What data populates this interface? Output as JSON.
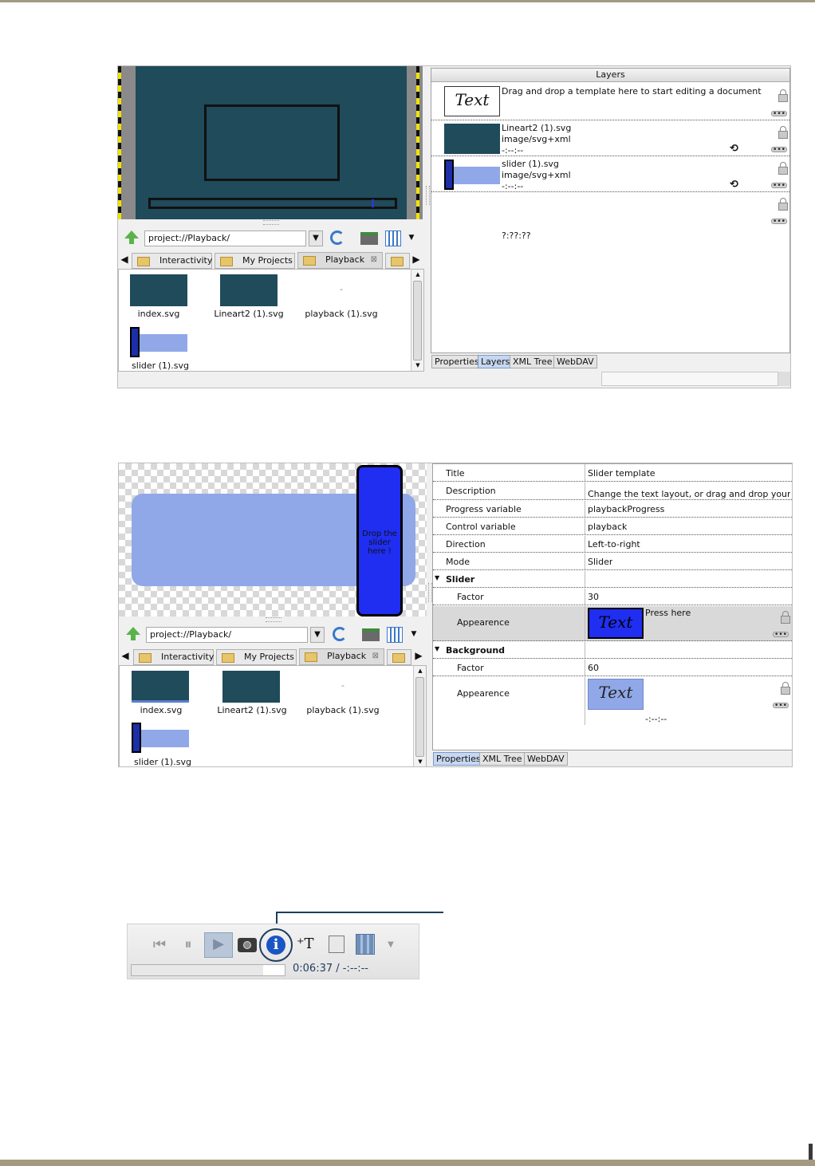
{
  "shot1": {
    "path": "project://Playback/",
    "tabs": [
      "Interactivity",
      "My Projects",
      "Playback"
    ],
    "files": [
      "index.svg",
      "Lineart2 (1).svg",
      "playback (1).svg",
      "slider (1).svg"
    ],
    "playback_thumb_text": "-",
    "layers": {
      "header": "Layers",
      "template_text": "Text",
      "template_hint": "Drag and drop a template here to start editing a document",
      "items": [
        {
          "name": "Lineart2 (1).svg",
          "mime": "image/svg+xml",
          "time": "-:--:--"
        },
        {
          "name": "slider (1).svg",
          "mime": "image/svg+xml",
          "time": "-:--:--"
        }
      ],
      "empty_time": "?:??:??"
    },
    "bottom_tabs": [
      "Properties",
      "Layers",
      "XML Tree",
      "WebDAV"
    ]
  },
  "shot2": {
    "drop_hint": "Drop the slider here !",
    "path": "project://Playback/",
    "tabs": [
      "Interactivity",
      "My Projects",
      "Playback"
    ],
    "files": [
      "index.svg",
      "Lineart2 (1).svg",
      "playback (1).svg",
      "slider (1).svg"
    ],
    "playback_thumb_text": "-",
    "properties": [
      {
        "key": "Title",
        "value": "Slider template"
      },
      {
        "key": "Description",
        "value": "Change the text layout, or drag and drop your ..."
      },
      {
        "key": "Progress variable",
        "value": "playbackProgress"
      },
      {
        "key": "Control variable",
        "value": "playback"
      },
      {
        "key": "Direction",
        "value": "Left-to-right"
      },
      {
        "key": "Mode",
        "value": "Slider"
      }
    ],
    "slider_group": {
      "label": "Slider",
      "factor_label": "Factor",
      "factor_value": "30",
      "appearance_label": "Appearence",
      "appearance_text": "Text",
      "appearance_hint": "Press here"
    },
    "background_group": {
      "label": "Background",
      "factor_label": "Factor",
      "factor_value": "60",
      "appearance_label": "Appearence",
      "appearance_text": "Text",
      "appearance_time": "-:--:--"
    },
    "bottom_tabs": [
      "Properties",
      "XML Tree",
      "WebDAV"
    ]
  },
  "toolbar": {
    "time": "0:06:37 / -:--:--",
    "progress": 0.86,
    "icons": [
      "skip-back-icon",
      "pause-icon",
      "play-icon",
      "camera-icon",
      "info-icon",
      "add-text-icon",
      "edit-icon",
      "book-icon",
      "chevron-down-icon"
    ]
  },
  "colors": {
    "stage": "#1f4b5b",
    "slider_bar": "#90a8e8",
    "slider_knob": "#1c2ea8",
    "info_button": "#1a55c4",
    "callout_line": "#1f3c5f",
    "page_rule": "#a39a80"
  }
}
